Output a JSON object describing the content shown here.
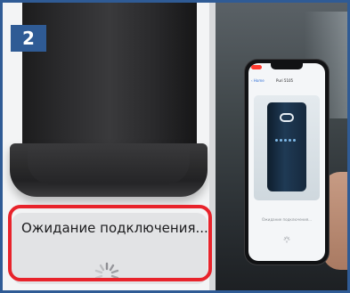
{
  "step": {
    "number": "2"
  },
  "status": {
    "message": "Ожидание подключения..."
  },
  "phone": {
    "back_label": "‹ Home",
    "title": "Puri 5105",
    "status_message": "Ожидание подключения..."
  },
  "colors": {
    "badge": "#2f5b95",
    "highlight": "#e8232b",
    "card": "#e2e3e5"
  },
  "icons": [
    "loading-spinner-icon",
    "device-logo-icon"
  ]
}
